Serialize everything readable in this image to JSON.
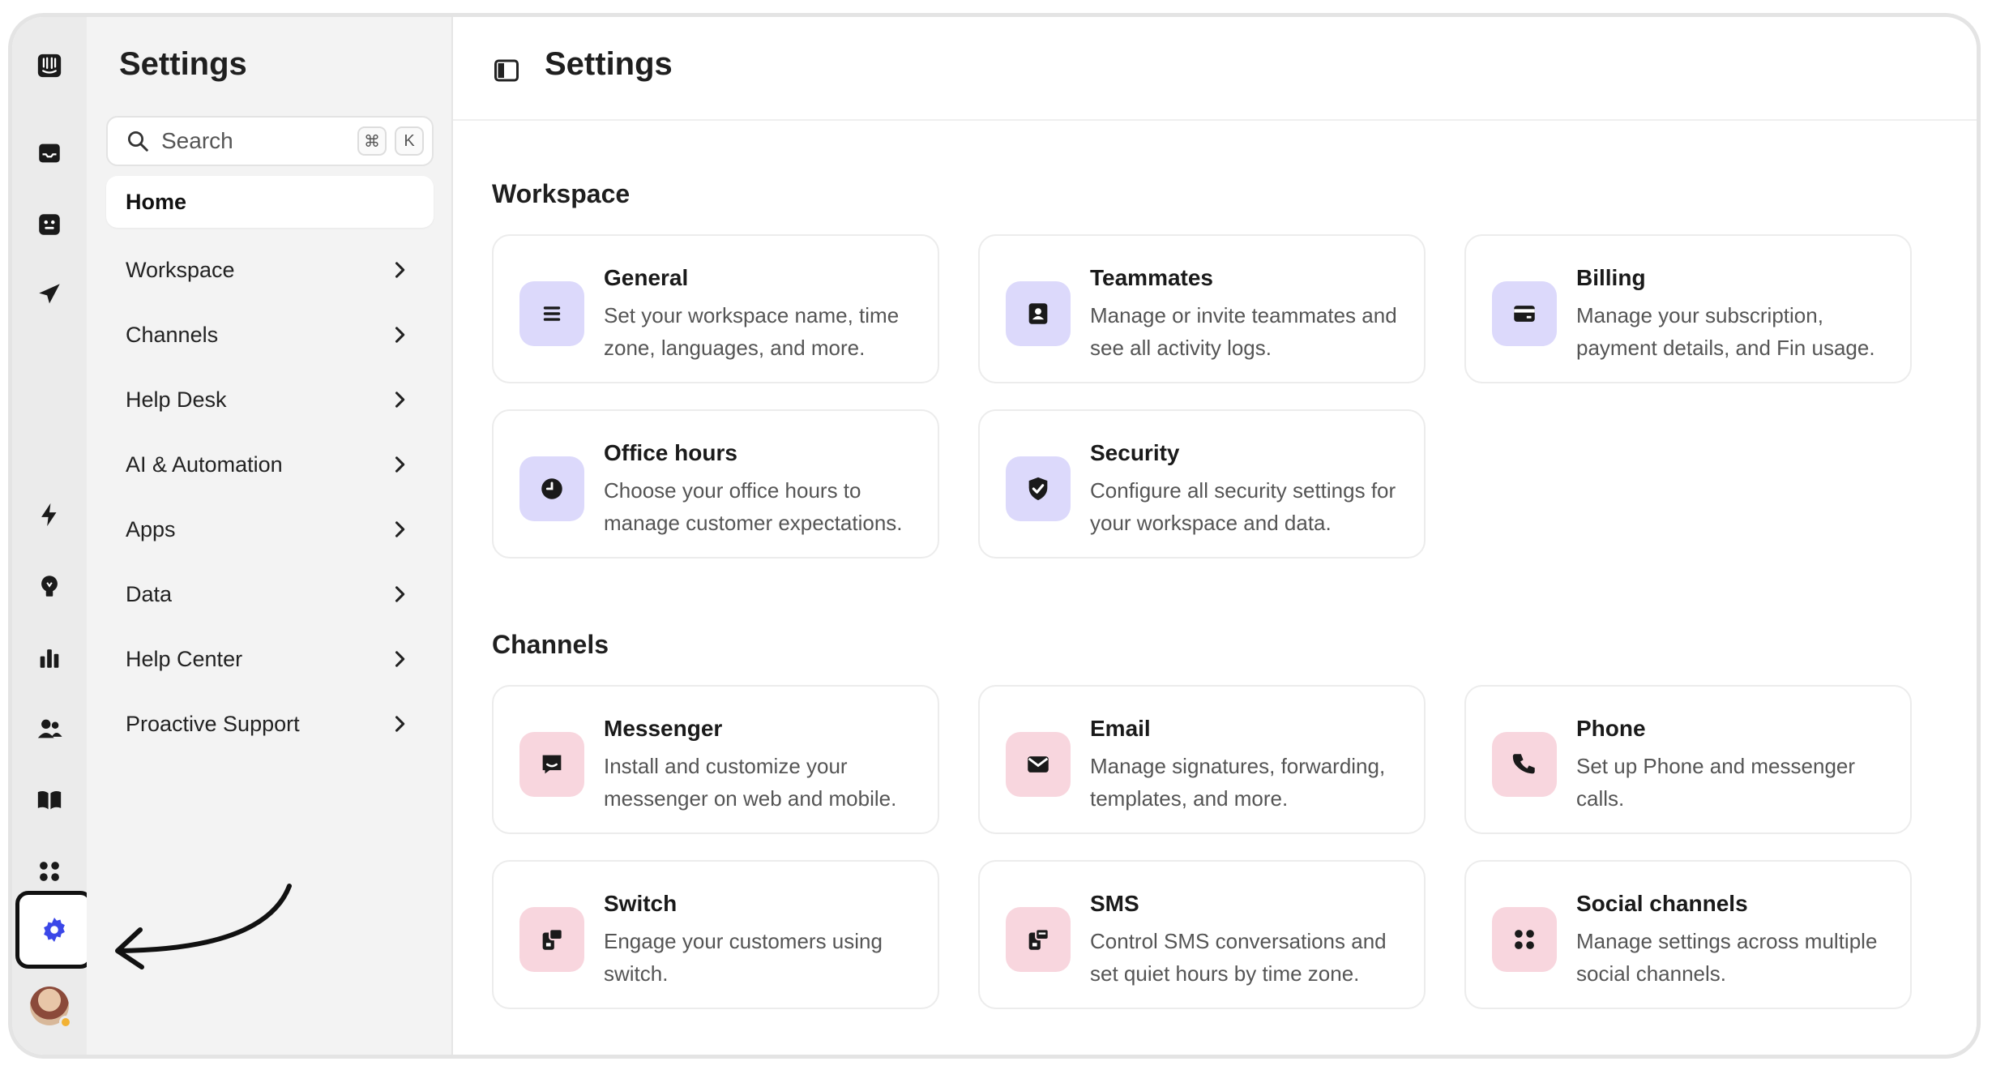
{
  "nav": {
    "title": "Settings",
    "search_placeholder": "Search",
    "search_shortcut_mod": "⌘",
    "search_shortcut_key": "K",
    "home": "Home",
    "items": [
      {
        "label": "Workspace"
      },
      {
        "label": "Channels"
      },
      {
        "label": "Help Desk"
      },
      {
        "label": "AI & Automation"
      },
      {
        "label": "Apps"
      },
      {
        "label": "Data"
      },
      {
        "label": "Help Center"
      },
      {
        "label": "Proactive Support"
      }
    ]
  },
  "header": {
    "title": "Settings"
  },
  "workspace": {
    "title": "Workspace",
    "cards": [
      {
        "title": "General",
        "desc": "Set your workspace name, time zone, languages, and more.",
        "icon": "list-icon"
      },
      {
        "title": "Teammates",
        "desc": "Manage or invite teammates and see all activity logs.",
        "icon": "contact-card-icon"
      },
      {
        "title": "Billing",
        "desc": "Manage your subscription, payment details, and Fin usage.",
        "icon": "credit-card-icon"
      },
      {
        "title": "Office hours",
        "desc": "Choose your office hours to manage customer expectations.",
        "icon": "clock-icon"
      },
      {
        "title": "Security",
        "desc": "Configure all security settings for your workspace and data.",
        "icon": "shield-check-icon"
      }
    ]
  },
  "channels": {
    "title": "Channels",
    "cards": [
      {
        "title": "Messenger",
        "desc": "Install and customize your messenger on web and mobile.",
        "icon": "messenger-icon"
      },
      {
        "title": "Email",
        "desc": "Manage signatures, forwarding, templates, and more.",
        "icon": "envelope-icon"
      },
      {
        "title": "Phone",
        "desc": "Set up Phone and messenger calls.",
        "icon": "phone-icon"
      },
      {
        "title": "Switch",
        "desc": "Engage your customers using switch.",
        "icon": "switch-icon"
      },
      {
        "title": "SMS",
        "desc": "Control SMS conversations and set quiet hours by time zone.",
        "icon": "sms-icon"
      },
      {
        "title": "Social channels",
        "desc": "Manage settings across multiple social channels.",
        "icon": "grid-icon"
      }
    ]
  },
  "colors": {
    "accent": "#3b47e8",
    "icon_purple_bg": "#dcd9fb",
    "icon_pink_bg": "#f8d6de",
    "rail_bg": "#ebebeb",
    "nav_bg": "#f3f3f3"
  }
}
